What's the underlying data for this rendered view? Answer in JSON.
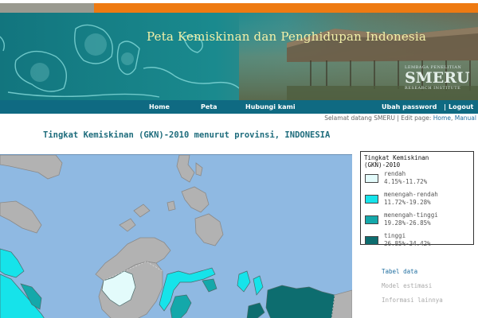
{
  "banner": {
    "title": "Peta Kemiskinan dan Penghidupan Indonesia",
    "logo": {
      "top_text": "LEMBAGA PENELITIAN",
      "name": "SMERU",
      "bottom_text": "RESEARCH INSTITUTE"
    }
  },
  "nav": {
    "home": "Home",
    "peta": "Peta",
    "hubungi": "Hubungi kami",
    "ubah_password": "Ubah password",
    "separator": "|",
    "logout": "Logout"
  },
  "welcome": {
    "prefix": "Selamat datang SMERU | Edit page: ",
    "link_home": "Home",
    "comma": ", ",
    "link_manual": "Manual"
  },
  "page": {
    "heading": "Tingkat Kemiskinan (GKN)-2010 menurut provinsi, INDONESIA"
  },
  "legend": {
    "title_line1": "Tingkat Kemiskinan",
    "title_line2": "(GKN)-2010",
    "items": [
      {
        "label": "rendah",
        "range": "4.15%-11.72%",
        "color": "#e3fbfb"
      },
      {
        "label": "menengah-rendah",
        "range": "11.72%-19.28%",
        "color": "#16e3ea"
      },
      {
        "label": "menengah-tinggi",
        "range": "19.28%-26.85%",
        "color": "#14a8aa"
      },
      {
        "label": "tinggi",
        "range": "26.85%-34.42%",
        "color": "#0d6d6f"
      }
    ]
  },
  "side_links": {
    "tabel_data": "Tabel data",
    "model_estimasi": "Model estimasi",
    "informasi_lainnya": "Informasi lainnya"
  },
  "colors": {
    "sea": "#8fb9e2",
    "other_land": "#b2b2b2",
    "nav_bg": "#0f6a82",
    "top_orange": "#ee7a12"
  }
}
